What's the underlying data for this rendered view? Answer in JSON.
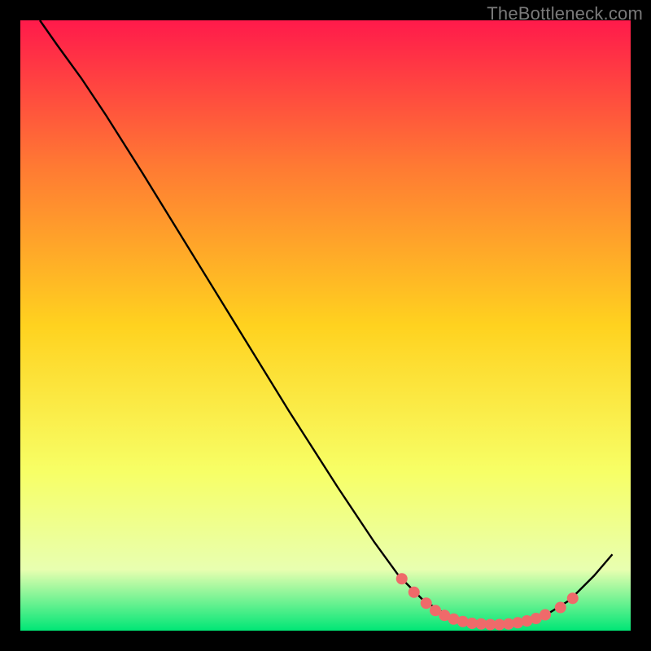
{
  "watermark": "TheBottleneck.com",
  "chart_data": {
    "type": "line",
    "xlim": [
      0,
      100
    ],
    "ylim": [
      0,
      100
    ],
    "title": "",
    "xlabel": "",
    "ylabel": "",
    "background_gradient": {
      "top": "#ff1a4b",
      "upper_mid": "#ff7a33",
      "mid": "#ffd21f",
      "lower_mid": "#f7ff66",
      "near_bottom": "#e8ffb0",
      "bottom": "#00e676"
    },
    "curve": [
      {
        "x": 3.2,
        "y": 100.0
      },
      {
        "x": 6.0,
        "y": 96.0
      },
      {
        "x": 10.0,
        "y": 90.5
      },
      {
        "x": 14.0,
        "y": 84.5
      },
      {
        "x": 20.0,
        "y": 75.0
      },
      {
        "x": 28.0,
        "y": 62.0
      },
      {
        "x": 36.0,
        "y": 49.0
      },
      {
        "x": 44.0,
        "y": 36.0
      },
      {
        "x": 52.0,
        "y": 23.5
      },
      {
        "x": 58.0,
        "y": 14.5
      },
      {
        "x": 62.0,
        "y": 9.0
      },
      {
        "x": 66.0,
        "y": 5.0
      },
      {
        "x": 70.0,
        "y": 2.5
      },
      {
        "x": 74.0,
        "y": 1.3
      },
      {
        "x": 78.0,
        "y": 1.0
      },
      {
        "x": 82.0,
        "y": 1.3
      },
      {
        "x": 86.0,
        "y": 2.5
      },
      {
        "x": 90.0,
        "y": 5.0
      },
      {
        "x": 94.0,
        "y": 9.0
      },
      {
        "x": 97.0,
        "y": 12.5
      }
    ],
    "markers": [
      {
        "x": 62.5,
        "y": 8.5
      },
      {
        "x": 64.5,
        "y": 6.3
      },
      {
        "x": 66.5,
        "y": 4.5
      },
      {
        "x": 68.0,
        "y": 3.3
      },
      {
        "x": 69.5,
        "y": 2.5
      },
      {
        "x": 71.0,
        "y": 1.9
      },
      {
        "x": 72.5,
        "y": 1.5
      },
      {
        "x": 74.0,
        "y": 1.2
      },
      {
        "x": 75.5,
        "y": 1.1
      },
      {
        "x": 77.0,
        "y": 1.0
      },
      {
        "x": 78.5,
        "y": 1.0
      },
      {
        "x": 80.0,
        "y": 1.1
      },
      {
        "x": 81.5,
        "y": 1.3
      },
      {
        "x": 83.0,
        "y": 1.6
      },
      {
        "x": 84.5,
        "y": 2.0
      },
      {
        "x": 86.0,
        "y": 2.6
      },
      {
        "x": 88.5,
        "y": 3.8
      },
      {
        "x": 90.5,
        "y": 5.3
      }
    ],
    "marker_color": "#ef6a6a",
    "curve_color": "#000000"
  }
}
